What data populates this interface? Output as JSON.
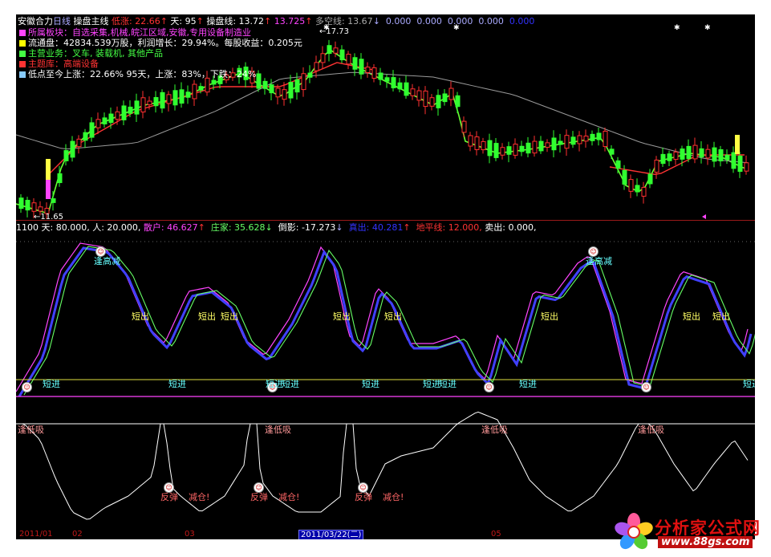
{
  "header": {
    "stock": "安徽合力",
    "period": "日线",
    "indicator": "操盘主线",
    "low_up_label": "低涨: 22.66",
    "low_up_arrow": "↑",
    "days_label": "天: 95",
    "days_arrow": "↑",
    "op_line_label": "操盘线: 13.72",
    "op_line_arrow": "↑",
    "op_line2": "13.725",
    "op_line2_arrow": "↑",
    "longshort_label": "多空线: 13.67",
    "longshort_arrow": "↓",
    "zeros": [
      "0.000",
      "0.000",
      "0.000",
      "0.000",
      "0.000"
    ]
  },
  "info": [
    {
      "label": "所属板块：自选采集,机械,皖江区域,安徽,专用设备制造业",
      "color": "#ff44ff",
      "sq": "#ff44ff"
    },
    {
      "label": "流通盘：42834.539万股，利润增长：29.94%。每股收益：0.205元",
      "color": "#ffffff",
      "sq": "#ffff00"
    },
    {
      "label": "主营业务：叉车, 装载机, 其他产品",
      "color": "#44ff44",
      "sq": "#44ff44"
    },
    {
      "label": "主题库：高端设备",
      "color": "#ff3333",
      "sq": "#ff3333"
    },
    {
      "label": "低点至今上涨：22.66% 95天，上涨：83%，下跌：24%",
      "color": "#ffffff",
      "sq": "#88ccff"
    }
  ],
  "price_labels": {
    "high": "17.73",
    "low": "11.65"
  },
  "indicator_bar": {
    "prefix": "1100",
    "day": "天: 80.000,",
    "ren": "人: 20.000,",
    "sanhu": "散户: 46.627",
    "sanhu_arrow": "↑",
    "zhuangjia": "庄家: 35.628",
    "zhuangjia_arrow": "↓",
    "daoying": "倒影: -17.273",
    "daoying_arrow": "↓",
    "maichu_label": "真出: 40.281",
    "maichu_arrow": "↑",
    "diping": "地平线: 12.000,",
    "sell": "卖出: 0.000,"
  },
  "signals": {
    "short_out": "短出",
    "short_in": "短进",
    "high_reduce": "逢高减",
    "low_absorb": "逢低吸",
    "rebound": "反弹",
    "reduce": "减仓!"
  },
  "dates": {
    "d1": "2011/01",
    "d2": "02",
    "d3": "03",
    "selected": "2011/03/22(二)",
    "d5": "05"
  },
  "logo": {
    "text": "分析家公式网",
    "url": "www.88gs.com"
  },
  "colors": {
    "bull_candle": "#ff3030",
    "bear_candle": "#30ff30",
    "ma_green": "#66ff33",
    "ma_red": "#ff3333",
    "ma_grey": "#9a9a9a",
    "osc_pink": "#ff44ff",
    "osc_blue": "#4040ff",
    "osc_green": "#66ff66",
    "sell_text": "#ffff66",
    "buy_text": "#ffff66"
  }
}
